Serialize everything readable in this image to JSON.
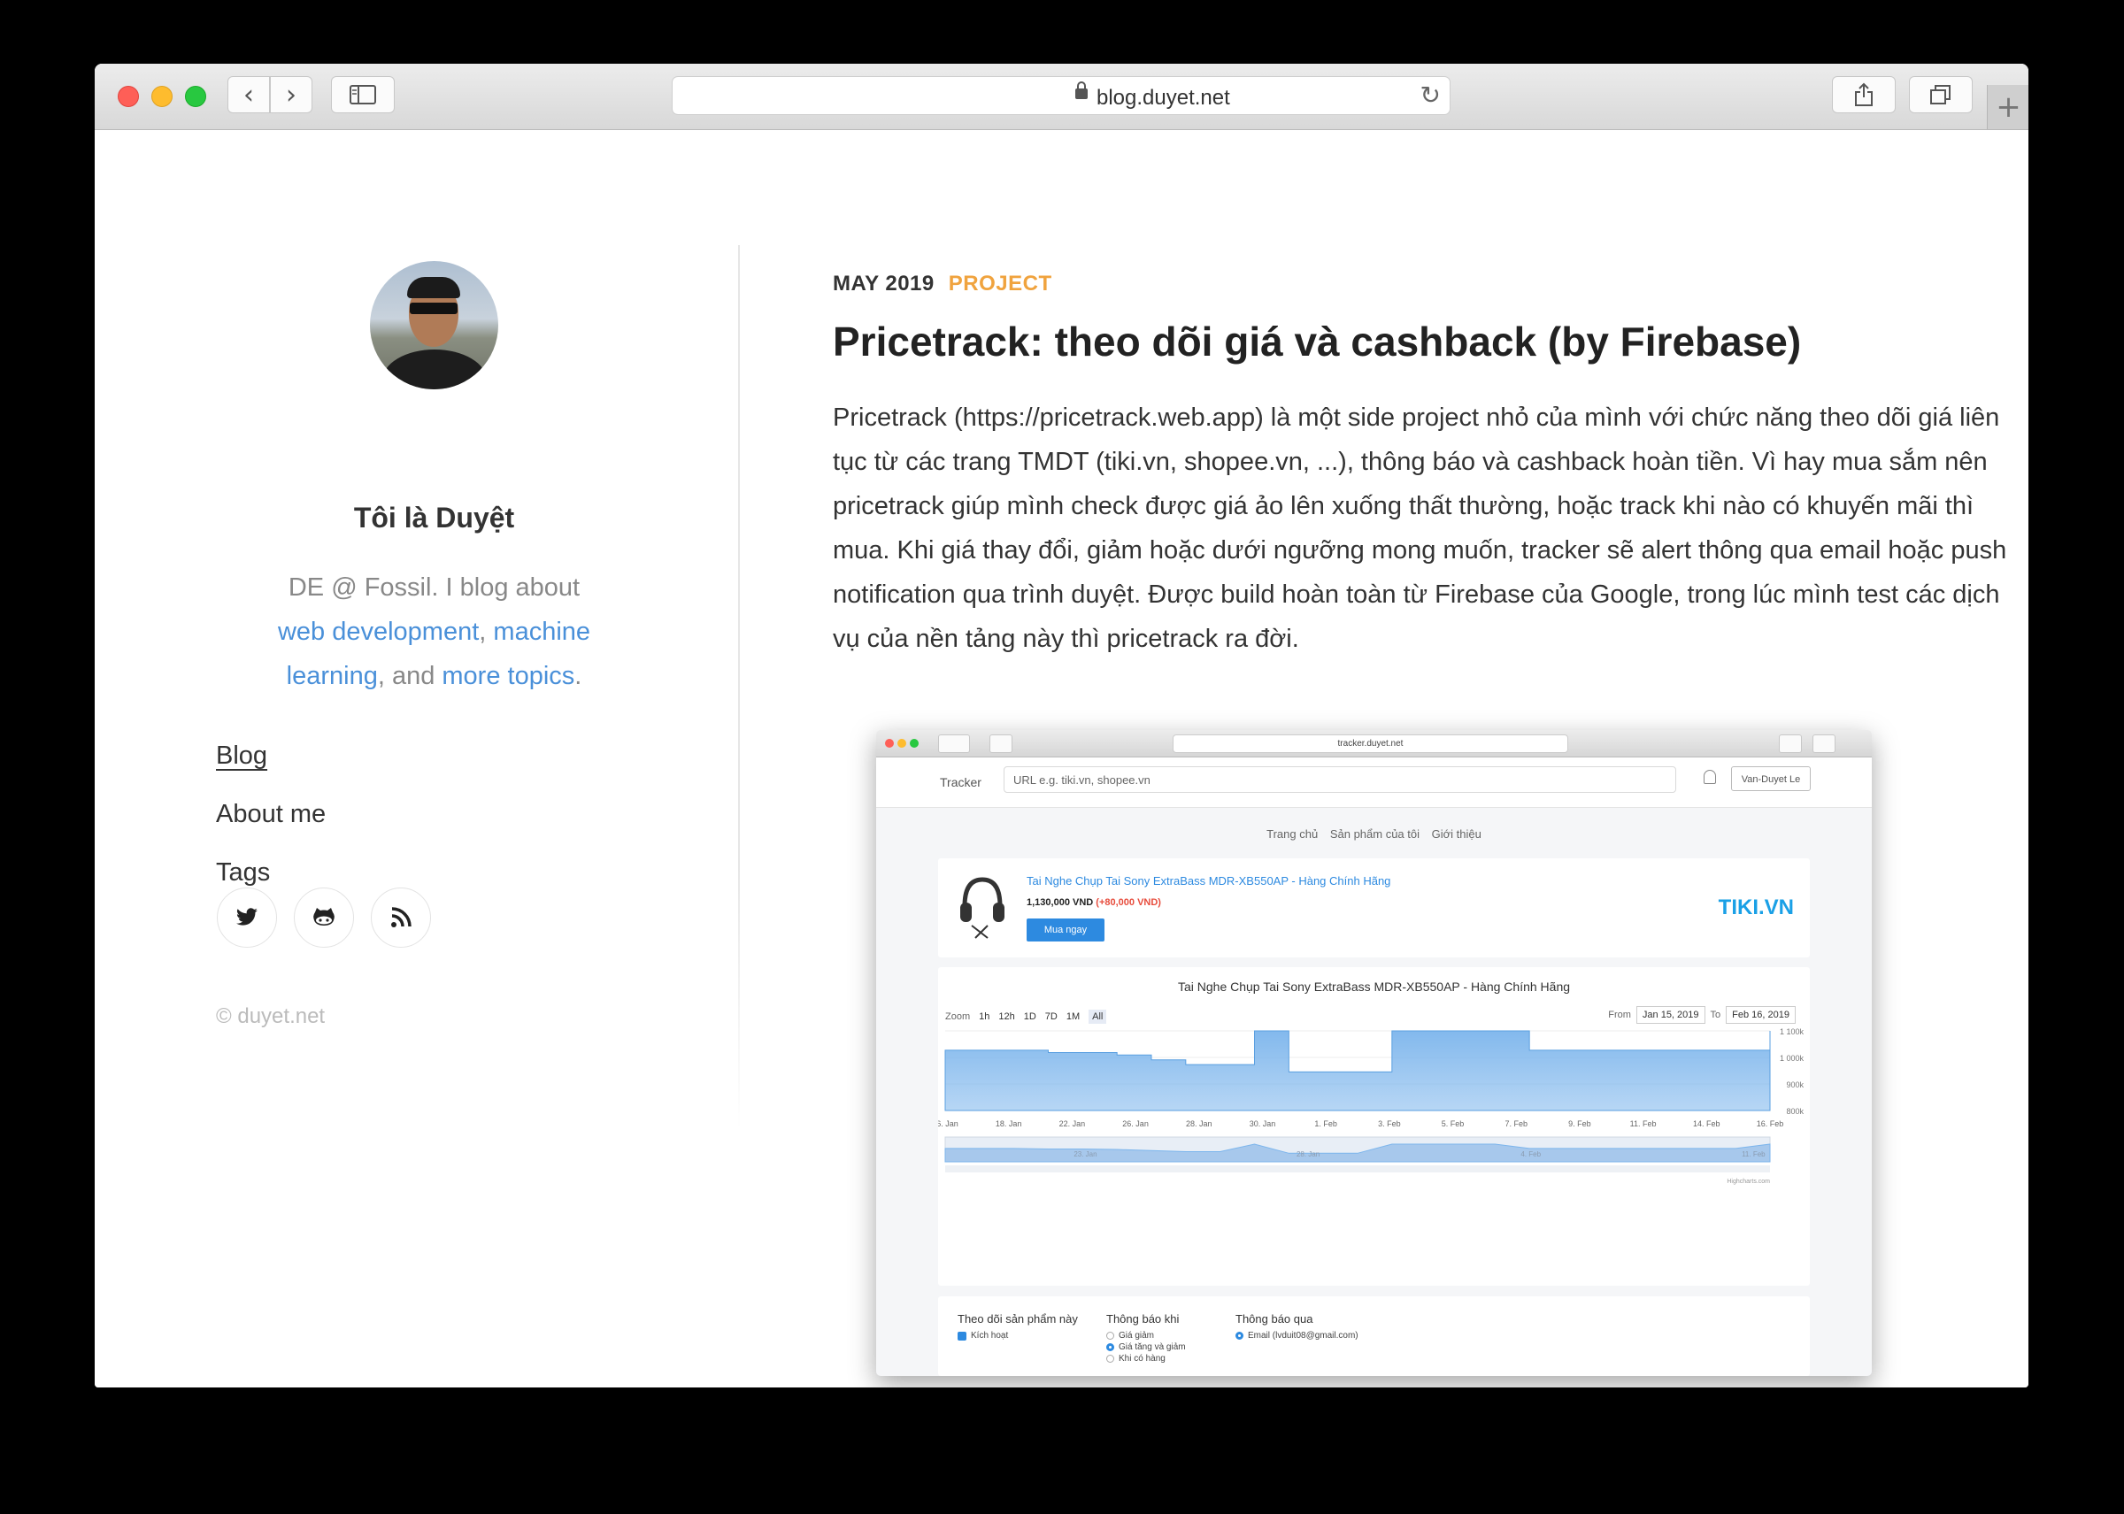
{
  "browser": {
    "url": "blog.duyet.net"
  },
  "sidebar": {
    "author_name": "Tôi là Duyệt",
    "bio_prefix": "DE @ Fossil. I blog about ",
    "bio_link_web": "web development",
    "bio_sep1": ", ",
    "bio_link_ml": "machine learning",
    "bio_sep2": ", and ",
    "bio_link_more": "more topics",
    "bio_suffix": ".",
    "nav": [
      {
        "label": "Blog",
        "active": true
      },
      {
        "label": "About me"
      },
      {
        "label": "Tags"
      }
    ],
    "social": [
      "twitter-icon",
      "github-icon",
      "rss-icon"
    ],
    "copyright": "© duyet.net"
  },
  "post": {
    "date": "MAY 2019",
    "category": "PROJECT",
    "title": "Pricetrack: theo dõi giá và cashback (by Firebase)",
    "body": "Pricetrack (https://pricetrack.web.app) là một side project nhỏ của mình với chức năng theo dõi giá liên tục từ các trang TMDT (tiki.vn, shopee.vn, ...), thông báo và cashback hoàn tiền. Vì hay mua sắm nên pricetrack giúp mình check được giá ảo lên xuống thất thường, hoặc track khi nào có khuyến mãi thì mua. Khi giá thay đổi, giảm hoặc dưới ngưỡng mong muốn, tracker sẽ alert thông qua email hoặc push notification qua trình duyệt. Được build hoàn toàn từ Firebase của Google, trong lúc mình test các dịch vụ của nền tảng này thì pricetrack ra đời."
  },
  "screenshot": {
    "url": "tracker.duyet.net",
    "brand": "Tracker",
    "search_placeholder": "URL e.g. tiki.vn, shopee.vn",
    "user": "Van-Duyet Le",
    "subnav": [
      "Trang chủ",
      "Sản phẩm của tôi",
      "Giới thiệu"
    ],
    "product_name": "Tai Nghe Chụp Tai Sony ExtraBass MDR-XB550AP - Hàng Chính Hãng",
    "price": "1,130,000 VND",
    "price_change": "(+80,000 VND)",
    "buy_label": "Mua ngay",
    "store_logo": "TIKI.VN",
    "chart_title": "Tai Nghe Chụp Tai Sony ExtraBass MDR-XB550AP - Hàng Chính Hãng",
    "zoom_label": "Zoom",
    "zoom_options": [
      "1h",
      "12h",
      "1D",
      "7D",
      "1M",
      "All"
    ],
    "from_label": "From",
    "from_date": "Jan 15, 2019",
    "to_label": "To",
    "to_date": "Feb 16, 2019",
    "credit": "Highcharts.com",
    "form": {
      "col1_title": "Theo dõi sản phẩm này",
      "col1_opt": "Kích hoạt",
      "col2_title": "Thông báo khi",
      "col2_opts": [
        "Giá giảm",
        "Giá tăng và giảm",
        "Khi có hàng"
      ],
      "col3_title": "Thông báo qua",
      "col3_opt": "Email (lvduit08@gmail.com)"
    }
  },
  "chart_data": {
    "type": "area",
    "x_tick_labels": [
      "16. Jan",
      "18. Jan",
      "22. Jan",
      "26. Jan",
      "28. Jan",
      "30. Jan",
      "1. Feb",
      "3. Feb",
      "5. Feb",
      "7. Feb",
      "9. Feb",
      "11. Feb",
      "14. Feb",
      "16. Feb"
    ],
    "y_tick_labels": [
      "1 100k",
      "1 000k",
      "900k",
      "800k"
    ],
    "navigator_labels": [
      "23. Jan",
      "28. Jan",
      "4. Feb",
      "11. Feb"
    ],
    "ylim": [
      800000,
      1130000
    ],
    "x": [
      "Jan 16",
      "Jan 17",
      "Jan 18",
      "Jan 19",
      "Jan 20",
      "Jan 22",
      "Jan 24",
      "Jan 26",
      "Jan 27",
      "Jan 28",
      "Jan 29",
      "Jan 30",
      "Jan 31",
      "Feb 1",
      "Feb 2",
      "Feb 3",
      "Feb 4",
      "Feb 5",
      "Feb 6",
      "Feb 8",
      "Feb 10",
      "Feb 12",
      "Feb 14",
      "Feb 15",
      "Feb 16"
    ],
    "y": [
      1050000,
      1050000,
      1050000,
      1040000,
      1040000,
      1030000,
      1010000,
      990000,
      990000,
      1130000,
      960000,
      960000,
      960000,
      1130000,
      1130000,
      1130000,
      1130000,
      1050000,
      1050000,
      1050000,
      1050000,
      1050000,
      1050000,
      1050000,
      1130000
    ],
    "series_color": "#7cb5ec"
  }
}
